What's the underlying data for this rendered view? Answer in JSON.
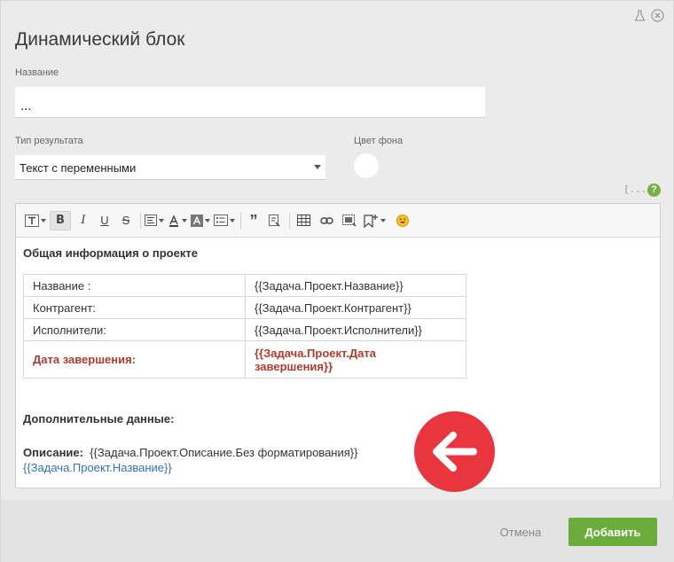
{
  "dialog": {
    "title": "Динамический блок",
    "name_label": "Название",
    "name_value": "...",
    "result_type_label": "Тип результата",
    "result_type_value": "Текст с переменными",
    "bg_color_label": "Цвет фона",
    "variables_icon_text": "[...]",
    "help_icon_text": "?"
  },
  "toolbar": {
    "icons": [
      "text-style-icon",
      "bold-icon",
      "italic-icon",
      "underline-icon",
      "strikethrough-icon",
      "align-icon",
      "font-color-icon",
      "bg-color-icon",
      "list-icon",
      "quote-icon",
      "clear-format-icon",
      "table-icon",
      "link-icon",
      "image-icon",
      "insert-icon",
      "emoji-icon"
    ]
  },
  "editor": {
    "heading": "Общая информация о проекте",
    "table": [
      {
        "key": "Название :",
        "value": "{{Задача.Проект.Название}}"
      },
      {
        "key": "Контрагент:",
        "value": "{{Задача.Проект.Контрагент}}"
      },
      {
        "key": "Исполнители:",
        "value": "{{Задача.Проект.Исполнители}}"
      },
      {
        "key": "Дата завершения:",
        "value": "{{Задача.Проект.Дата завершения}}"
      }
    ],
    "extra_heading": "Дополнительные данные:",
    "desc_label": "Описание:",
    "desc_value": "{{Задача.Проект.Описание.Без форматирования}}",
    "link_value": "{{Задача.Проект.Название}}"
  },
  "footer": {
    "cancel_label": "Отмена",
    "add_label": "Добавить"
  },
  "colors": {
    "accent_green": "#6bac3d",
    "badge_red": "#e8353e",
    "highlight_red": "#b03a2e",
    "link_blue": "#2f73b5"
  }
}
